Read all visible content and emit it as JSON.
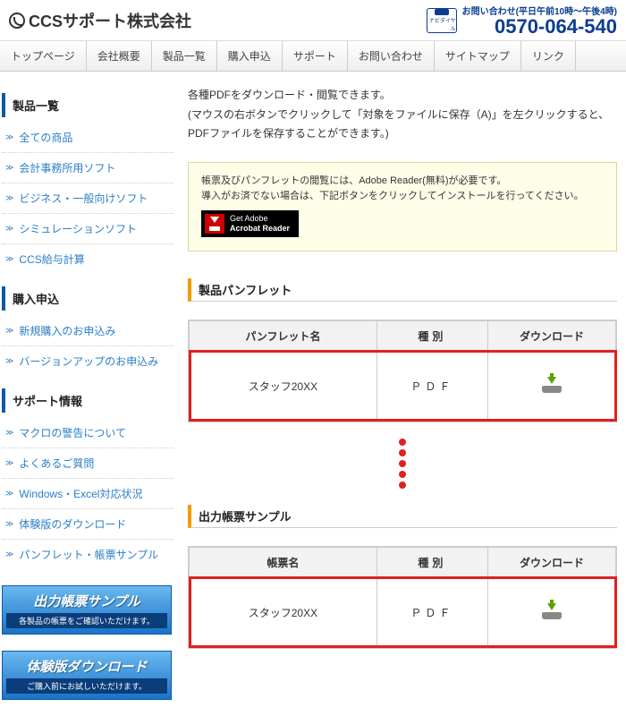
{
  "header": {
    "company": "CCSサポート株式会社",
    "contact_label": "お問い合わせ(平日午前10時～午後4時)",
    "tel": "0570-064-540",
    "navidial": "ナビダイヤル"
  },
  "nav": [
    "トップページ",
    "会社概要",
    "製品一覧",
    "購入申込",
    "サポート",
    "お問い合わせ",
    "サイトマップ",
    "リンク"
  ],
  "side": {
    "sections": [
      {
        "title": "製品一覧",
        "items": [
          "全ての商品",
          "会計事務所用ソフト",
          "ビジネス・一般向けソフト",
          "シミュレーションソフト",
          "CCS給与計算"
        ]
      },
      {
        "title": "購入申込",
        "items": [
          "新規購入のお申込み",
          "バージョンアップのお申込み"
        ]
      },
      {
        "title": "サポート情報",
        "items": [
          "マクロの警告について",
          "よくあるご質問",
          "Windows・Excel対応状況",
          "体験版のダウンロード",
          "パンフレット・帳票サンプル"
        ]
      }
    ],
    "banners": [
      {
        "title": "出力帳票サンプル",
        "sub": "各製品の帳票をご確認いただけます。"
      },
      {
        "title": "体験版ダウンロード",
        "sub": "ご購入前にお試しいただけます。"
      }
    ]
  },
  "main": {
    "intro1": "各種PDFをダウンロード・閲覧できます。",
    "intro2": "(マウスの右ボタンでクリックして「対象をファイルに保存（A)」を左クリックすると、PDFファイルを保存することができます。)",
    "reader_note1": "帳票及びパンフレットの閲覧には、Adobe Reader(無料)が必要です。",
    "reader_note2": "導入がお済でない場合は、下記ボタンをクリックしてインストールを行ってください。",
    "reader_btn1": "Get Adobe",
    "reader_btn2": "Acrobat Reader",
    "section1": "製品パンフレット",
    "section2": "出力帳票サンプル",
    "table1": {
      "headers": [
        "パンフレット名",
        "種別",
        "ダウンロード"
      ],
      "row": {
        "name": "スタッフ20XX",
        "type": "ＰＤＦ"
      }
    },
    "table2": {
      "headers": [
        "帳票名",
        "種別",
        "ダウンロード"
      ],
      "row": {
        "name": "スタッフ20XX",
        "type": "ＰＤＦ"
      }
    }
  }
}
